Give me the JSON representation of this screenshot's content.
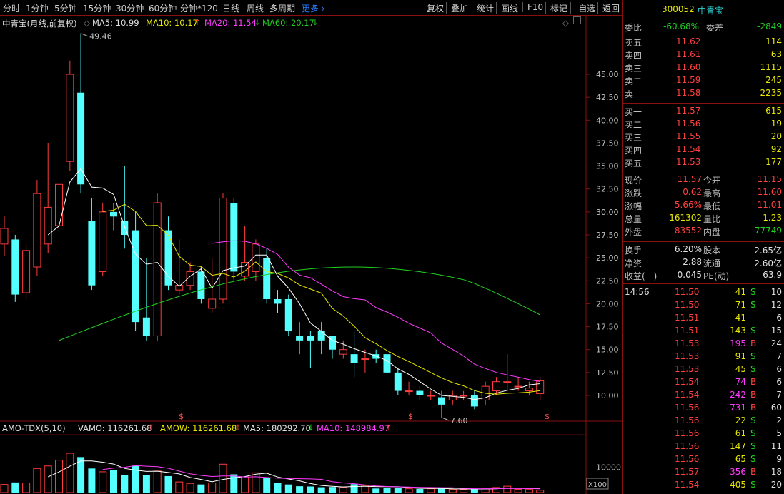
{
  "toolbar": {
    "left": [
      "分时",
      "1分钟",
      "5分钟",
      "15分钟",
      "30分钟",
      "60分钟",
      "分钟*120",
      "日线",
      "周线",
      "多周期"
    ],
    "more": "更多",
    "right": [
      "复权",
      "叠加",
      "统计",
      "画线",
      "F10",
      "标记",
      "-自选",
      "返回"
    ]
  },
  "main": {
    "title": "中青宝(月线,前复权)",
    "ma5": "MA5: 10.99",
    "ma10": "MA10: 10.17",
    "ma20": "MA20: 11.54",
    "ma60": "MA60: 20.17",
    "high_label": "49.46",
    "low_label": "7.60",
    "yticks": [
      "45.00",
      "42.50",
      "40.00",
      "37.50",
      "35.00",
      "32.50",
      "30.00",
      "27.50",
      "25.00",
      "22.50",
      "20.00",
      "17.50",
      "15.00",
      "12.50",
      "10.00"
    ],
    "signals": [
      "$",
      "$",
      "$"
    ]
  },
  "volume": {
    "title": "AMO-TDX(5,10)",
    "vamo": "VAMO: 116261.68",
    "amow": "AMOW: 116261.68",
    "ma5": "MA5: 180292.70",
    "ma10": "MA10: 148984.97",
    "ytick": "10000",
    "unit": "X100"
  },
  "colors": {
    "up": "#ff3c3c",
    "down": "#54ffff",
    "ma5": "#ffffff",
    "ma10": "#e8e800",
    "ma20": "#ff3cff",
    "ma60": "#20d020",
    "border": "#8a1010"
  },
  "quote": {
    "code": "300052",
    "name": "中青宝",
    "weibi_label": "委比",
    "weibi": "-60.68%",
    "weicha_label": "委差",
    "weicha": "-2849",
    "asks": [
      {
        "label": "卖五",
        "price": "11.62",
        "vol": "114"
      },
      {
        "label": "卖四",
        "price": "11.61",
        "vol": "63"
      },
      {
        "label": "卖三",
        "price": "11.60",
        "vol": "1115"
      },
      {
        "label": "卖二",
        "price": "11.59",
        "vol": "245"
      },
      {
        "label": "卖一",
        "price": "11.58",
        "vol": "2235"
      }
    ],
    "bids": [
      {
        "label": "买一",
        "price": "11.57",
        "vol": "615"
      },
      {
        "label": "买二",
        "price": "11.56",
        "vol": "19"
      },
      {
        "label": "买三",
        "price": "11.55",
        "vol": "20"
      },
      {
        "label": "买四",
        "price": "11.54",
        "vol": "92"
      },
      {
        "label": "买五",
        "price": "11.53",
        "vol": "177"
      }
    ],
    "stats": [
      {
        "l1": "现价",
        "v1": "11.57",
        "l2": "今开",
        "v2": "11.15"
      },
      {
        "l1": "涨跌",
        "v1": "0.62",
        "l2": "最高",
        "v2": "11.60"
      },
      {
        "l1": "涨幅",
        "v1": "5.66%",
        "l2": "最低",
        "v2": "11.01"
      },
      {
        "l1": "总量",
        "v1": "161302",
        "l2": "量比",
        "v2": "1.23"
      },
      {
        "l1": "外盘",
        "v1": "83552",
        "l2": "内盘",
        "v2": "77749"
      }
    ],
    "fund": [
      {
        "l1": "换手",
        "v1": "6.20%",
        "l2": "股本",
        "v2": "2.65亿"
      },
      {
        "l1": "净资",
        "v1": "2.88",
        "l2": "流通",
        "v2": "2.60亿"
      },
      {
        "l1": "收益(一)",
        "v1": "0.045",
        "l2": "PE(动)",
        "v2": "63.9"
      }
    ],
    "ticks_time": "14:56",
    "ticks": [
      {
        "price": "11.50",
        "vol": "41",
        "bs": "S",
        "n": "10"
      },
      {
        "price": "11.50",
        "vol": "71",
        "bs": "S",
        "n": "12"
      },
      {
        "price": "11.51",
        "vol": "41",
        "bs": "",
        "n": "6"
      },
      {
        "price": "11.51",
        "vol": "143",
        "bs": "S",
        "n": "15"
      },
      {
        "price": "11.53",
        "vol": "195",
        "bs": "B",
        "n": "24"
      },
      {
        "price": "11.53",
        "vol": "91",
        "bs": "S",
        "n": "7"
      },
      {
        "price": "11.53",
        "vol": "45",
        "bs": "S",
        "n": "6"
      },
      {
        "price": "11.54",
        "vol": "74",
        "bs": "B",
        "n": "6"
      },
      {
        "price": "11.54",
        "vol": "242",
        "bs": "B",
        "n": "7"
      },
      {
        "price": "11.56",
        "vol": "731",
        "bs": "B",
        "n": "60"
      },
      {
        "price": "11.56",
        "vol": "22",
        "bs": "S",
        "n": "2"
      },
      {
        "price": "11.56",
        "vol": "61",
        "bs": "S",
        "n": "5"
      },
      {
        "price": "11.56",
        "vol": "147",
        "bs": "S",
        "n": "11"
      },
      {
        "price": "11.56",
        "vol": "65",
        "bs": "S",
        "n": "9"
      },
      {
        "price": "11.57",
        "vol": "356",
        "bs": "B",
        "n": "18"
      },
      {
        "price": "11.54",
        "vol": "405",
        "bs": "S",
        "n": "20"
      }
    ]
  }
}
